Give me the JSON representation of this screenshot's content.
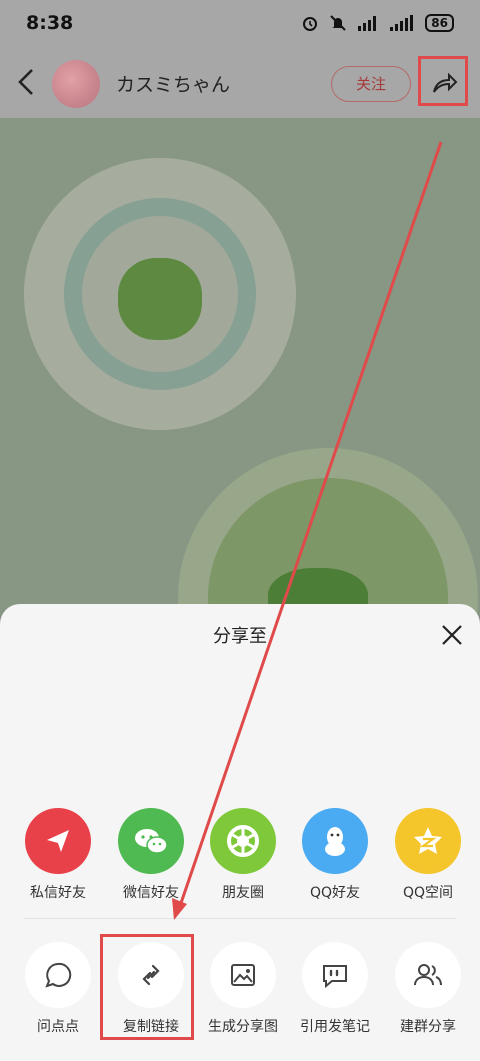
{
  "status": {
    "time": "8:38",
    "battery": "86"
  },
  "header": {
    "author": "カスミちゃん",
    "follow_label": "关注"
  },
  "sheet": {
    "title": "分享至",
    "row1": [
      {
        "label": "私信好友",
        "icon": "send-icon",
        "color": "#e9414a"
      },
      {
        "label": "微信好友",
        "icon": "wechat-icon",
        "color": "#4fb952"
      },
      {
        "label": "朋友圈",
        "icon": "moments-icon",
        "color": "#7ec83a"
      },
      {
        "label": "QQ好友",
        "icon": "qq-icon",
        "color": "#4aabf2"
      },
      {
        "label": "QQ空间",
        "icon": "qzone-icon",
        "color": "#f5c52c"
      }
    ],
    "row2": [
      {
        "label": "问点点",
        "icon": "chat-bubble-icon"
      },
      {
        "label": "复制链接",
        "icon": "link-icon"
      },
      {
        "label": "生成分享图",
        "icon": "image-icon"
      },
      {
        "label": "引用发笔记",
        "icon": "quote-icon"
      },
      {
        "label": "建群分享",
        "icon": "group-icon"
      }
    ]
  },
  "colors": {
    "accent": "#e04a4a",
    "follow": "#a63a3a"
  }
}
